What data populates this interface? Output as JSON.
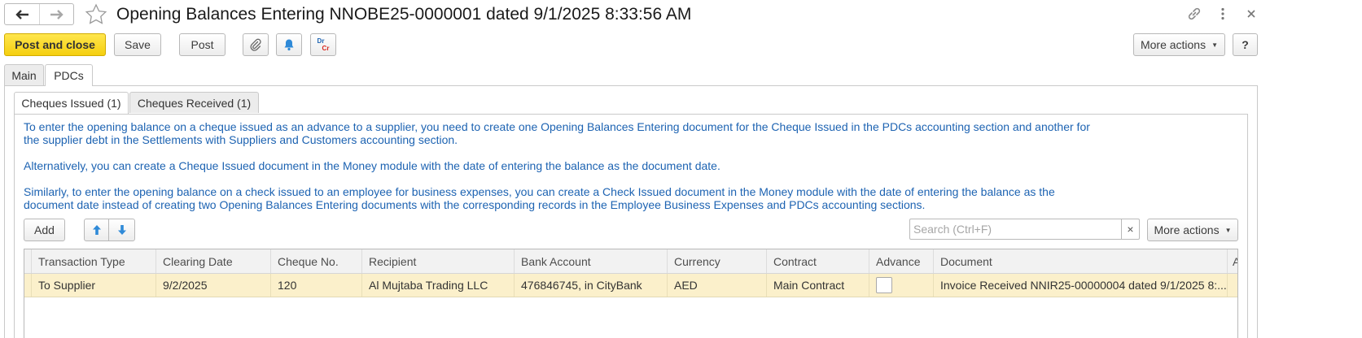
{
  "window": {
    "title": "Opening Balances Entering NNOBE25-0000001 dated 9/1/2025 8:33:56 AM",
    "nav_back_icon": "arrow-left-icon",
    "nav_forward_icon": "arrow-right-icon",
    "favorite_icon": "star-icon",
    "link_icon": "link-icon",
    "menu_icon": "kebab-menu-icon",
    "close_icon": "close-icon"
  },
  "toolbar": {
    "post_and_close": "Post and close",
    "save": "Save",
    "post": "Post",
    "attach_icon": "paperclip-icon",
    "notify_icon": "bell-icon",
    "drcr_top": "Dr",
    "drcr_bottom": "Cr",
    "more_actions": "More actions",
    "help": "?"
  },
  "tabs": {
    "main": "Main",
    "pdcs": "PDCs"
  },
  "subtabs": {
    "issued": "Cheques Issued (1)",
    "received": "Cheques Received (1)"
  },
  "info": {
    "p1_line1": "To enter the opening balance on a cheque issued as an advance to a supplier, you need to create one Opening Balances Entering document for the Cheque Issued in the PDCs accounting section and another for",
    "p1_line2": "the supplier debt in the Settlements with Suppliers and Customers accounting section.",
    "p2": "Alternatively, you can create a Cheque Issued document in the Money module with the date of entering the balance as the document date.",
    "p3_line1": "Similarly, to enter the opening balance on a check issued to an employee for business expenses, you can create a Check Issued document in the Money module with the date of entering the balance as the",
    "p3_line2": "document date instead of creating two Opening Balances Entering documents with the corresponding records in the Employee Business Expenses and PDCs accounting sections."
  },
  "table_toolbar": {
    "add": "Add",
    "move_up_icon": "arrow-up-icon",
    "move_down_icon": "arrow-down-icon",
    "search_placeholder": "Search (Ctrl+F)",
    "clear": "×",
    "more_actions": "More actions"
  },
  "table": {
    "columns": [
      "Transaction Type",
      "Clearing Date",
      "Cheque No.",
      "Recipient",
      "Bank Account",
      "Currency",
      "Contract",
      "Advance",
      "Document",
      "A"
    ],
    "rows": [
      {
        "transaction_type": "To Supplier",
        "clearing_date": "9/2/2025",
        "cheque_no": "120",
        "recipient": "Al Mujtaba Trading LLC",
        "bank_account": "476846745, in CityBank",
        "currency": "AED",
        "contract": "Main Contract",
        "advance": false,
        "document": "Invoice Received NNIR25-00000004 dated 9/1/2025 8:..."
      }
    ]
  },
  "colors": {
    "primary_button": "#f5cf0f",
    "info_text": "#1d63b2",
    "selected_row": "#fbf0cb",
    "arrow_blue": "#2f8ad8",
    "dr_text": "#1d63b2",
    "cr_text": "#d9261c"
  }
}
